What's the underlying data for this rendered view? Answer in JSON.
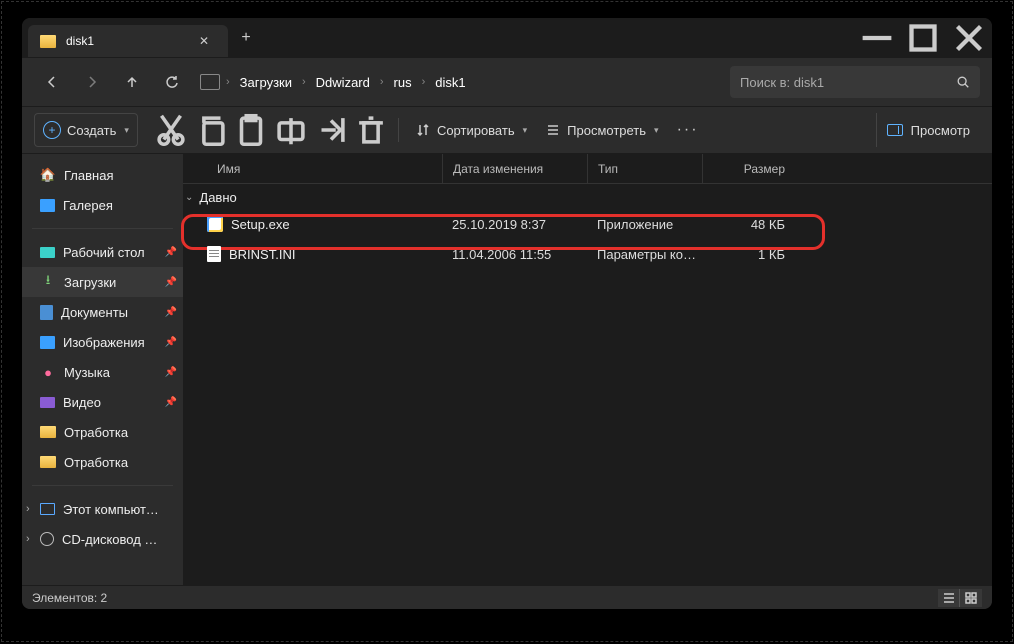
{
  "tab": {
    "title": "disk1"
  },
  "breadcrumb": [
    "Загрузки",
    "Ddwizard",
    "rus",
    "disk1"
  ],
  "search": {
    "placeholder": "Поиск в: disk1"
  },
  "toolbar": {
    "create": "Создать",
    "sort": "Сортировать",
    "view": "Просмотреть",
    "preview": "Просмотр"
  },
  "sidebar": [
    {
      "label": "Главная"
    },
    {
      "label": "Галерея"
    },
    {
      "label": "Рабочий стол"
    },
    {
      "label": "Загрузки"
    },
    {
      "label": "Документы"
    },
    {
      "label": "Изображения"
    },
    {
      "label": "Музыка"
    },
    {
      "label": "Видео"
    },
    {
      "label": "Отработка"
    },
    {
      "label": "Отработка"
    },
    {
      "label": "Этот компьютер"
    },
    {
      "label": "CD-дисковод (D:)"
    }
  ],
  "columns": {
    "name": "Имя",
    "date": "Дата изменения",
    "type": "Тип",
    "size": "Размер"
  },
  "group": "Давно",
  "files": [
    {
      "name": "Setup.exe",
      "date": "25.10.2019 8:37",
      "type": "Приложение",
      "size": "48 КБ"
    },
    {
      "name": "BRINST.INI",
      "date": "11.04.2006 11:55",
      "type": "Параметры конф...",
      "size": "1 КБ"
    }
  ],
  "status": {
    "count": "Элементов: 2"
  }
}
